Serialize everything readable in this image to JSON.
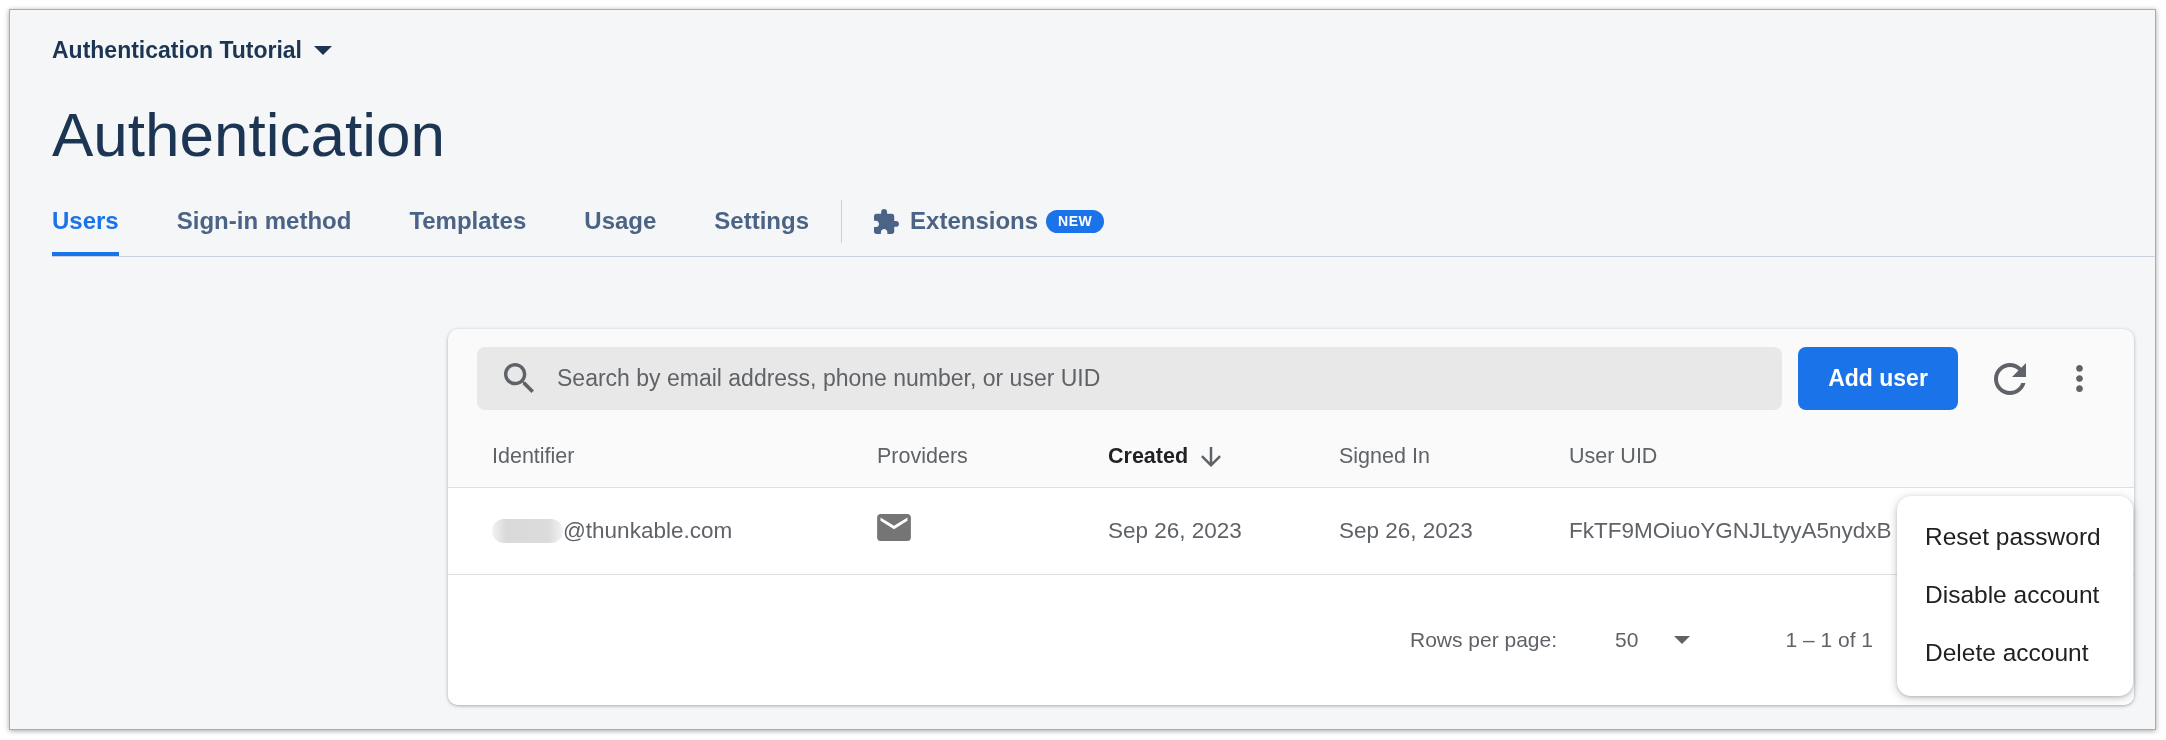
{
  "project": {
    "name": "Authentication Tutorial"
  },
  "title": "Authentication",
  "tabs": [
    {
      "label": "Users",
      "selected": true,
      "kind": "page"
    },
    {
      "label": "Sign-in method",
      "selected": false,
      "kind": "page"
    },
    {
      "label": "Templates",
      "selected": false,
      "kind": "page"
    },
    {
      "label": "Usage",
      "selected": false,
      "kind": "page"
    },
    {
      "label": "Settings",
      "selected": false,
      "kind": "page"
    },
    {
      "label": "Extensions",
      "selected": false,
      "kind": "extension",
      "badge": "NEW"
    }
  ],
  "users_table": {
    "search": {
      "placeholder": "Search by email address, phone number, or user UID"
    },
    "add_button": "Add user",
    "columns": [
      {
        "label": "Identifier",
        "sorted": false
      },
      {
        "label": "Providers",
        "sorted": false
      },
      {
        "label": "Created",
        "sorted": true
      },
      {
        "label": "Signed In",
        "sorted": false
      },
      {
        "label": "User UID",
        "sorted": false
      }
    ],
    "rows": [
      {
        "identifier": "@thunkable.com",
        "identifier_redacted": true,
        "created": "Sep 26, 2023",
        "signed_in": "Sep 26, 2023",
        "user_uid": "FkTF9MOiuoYGNJLtyyA5nydxB"
      }
    ],
    "footer": {
      "rows_per_page_label": "Rows per page:",
      "rows_per_page": "50",
      "range": "1 – 1 of 1"
    }
  },
  "row_menu": {
    "items": [
      "Reset password",
      "Disable account",
      "Delete account"
    ]
  }
}
